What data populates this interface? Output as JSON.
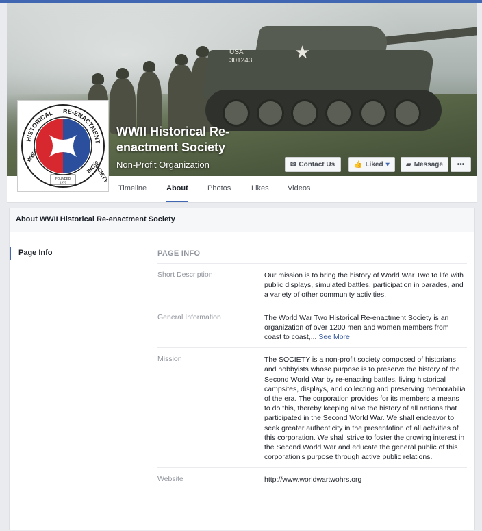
{
  "page": {
    "name_line1": "WWII Historical Re-",
    "name_line2": "enactment Society",
    "category": "Non-Profit Organization"
  },
  "logo": {
    "ring_text_top": "RE-ENACTMENT",
    "ring_text_left": "HISTORICAL",
    "ring_text_right": "SOCIETY",
    "ring_text_bottom_left": "WW II",
    "ring_text_bottom_right": "INC.",
    "founded": "FOUNDED",
    "year": "1976"
  },
  "cover": {
    "tank_marking_line1": "USA",
    "tank_marking_line2": "301243"
  },
  "actions": {
    "contact_label": "Contact Us",
    "contact_icon": "envelope-icon",
    "liked_label": "Liked",
    "liked_icon": "thumbs-up-icon",
    "message_label": "Message",
    "message_icon": "chat-icon",
    "more_label": "•••"
  },
  "tabs": [
    {
      "label": "Timeline"
    },
    {
      "label": "About"
    },
    {
      "label": "Photos"
    },
    {
      "label": "Likes"
    },
    {
      "label": "Videos"
    }
  ],
  "active_tab": "About",
  "about": {
    "title": "About WWII Historical Re-enactment Society",
    "nav_item": "Page Info",
    "section_title": "PAGE INFO",
    "rows": [
      {
        "label": "Short Description",
        "value": "Our mission is to bring the history of World War Two to life with public displays, simulated battles, participation in parades, and a variety of other community activities."
      },
      {
        "label": "General Information",
        "value": "The World War Two Historical Re-enactment Society is an organization of over 1200 men and women members from coast to coast,...",
        "more": "See More"
      },
      {
        "label": "Mission",
        "value": "The SOCIETY is a non-profit society composed of historians and hobbyists whose purpose is to preserve the history of the Second World War by re-enacting battles, living historical campsites, displays, and collecting and preserving memorabilia of the era. The corporation provides for its members a means to do this, thereby keeping alive the history of all nations that participated in the Second World War. We shall endeavor to seek greater authenticity in the presentation of all activities of this corporation. We shall strive to foster the growing interest in the Second World War and educate the general public of this corporation's purpose through active public relations."
      },
      {
        "label": "Website",
        "value": "http://www.worldwartwohrs.org"
      }
    ]
  },
  "colors": {
    "accent": "#4267b2",
    "link": "#365899",
    "logo_red": "#d7282f",
    "logo_blue": "#2b4f9c"
  }
}
